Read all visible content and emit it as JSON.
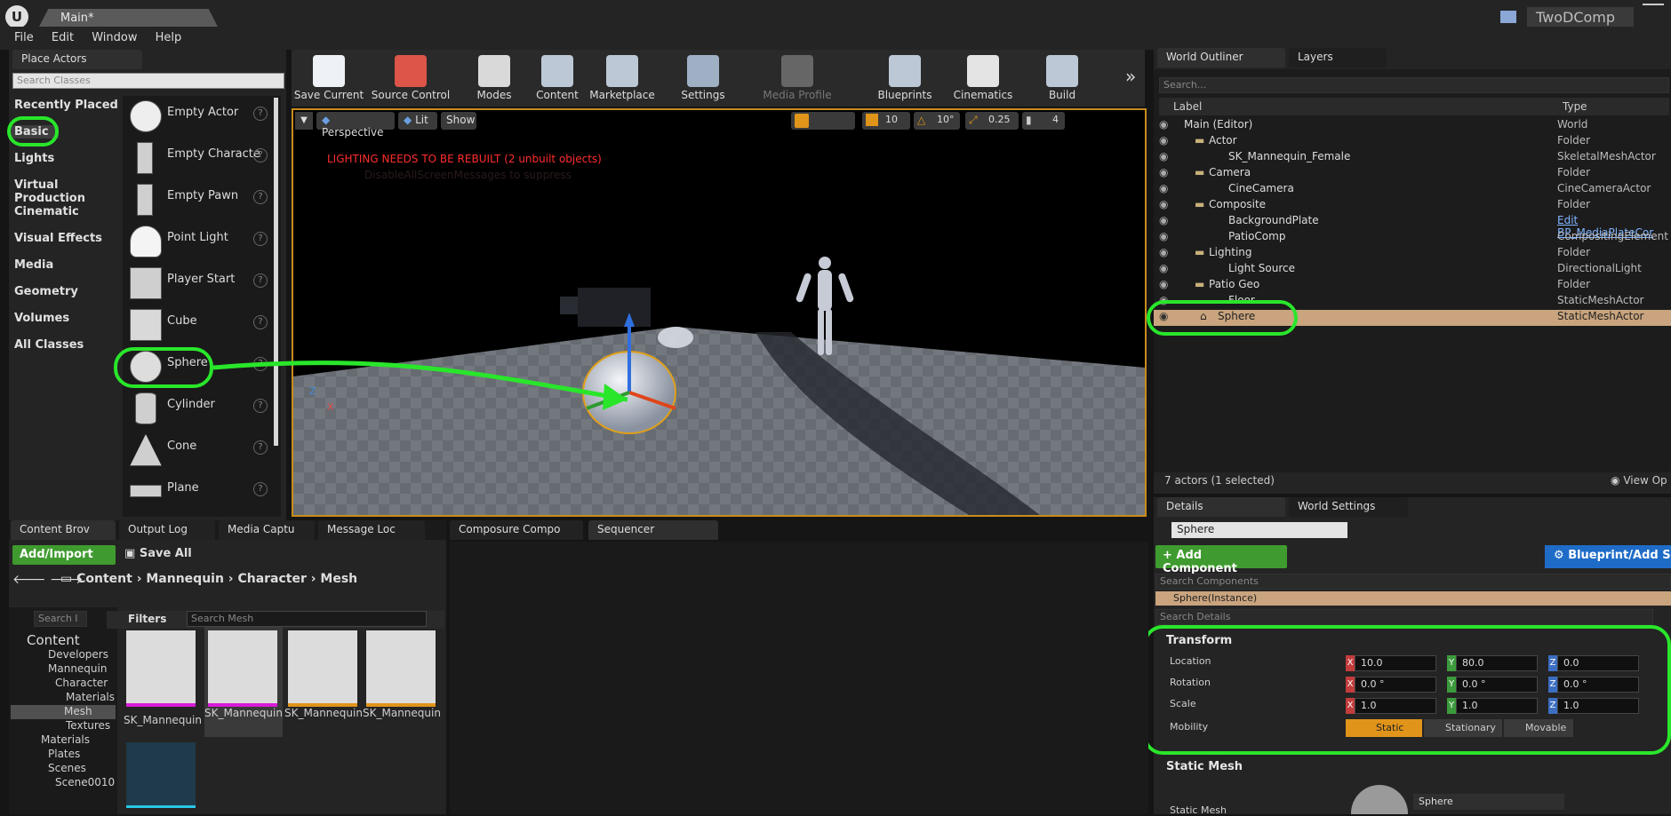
{
  "titlebar": {
    "tab": "Main*",
    "project": "TwoDComp"
  },
  "menu": [
    "File",
    "Edit",
    "Window",
    "Help"
  ],
  "place_actors": {
    "tab": "Place Actors",
    "search_placeholder": "Search Classes",
    "categories": [
      "Recently Placed",
      "Basic",
      "Lights",
      "Virtual Production",
      "Cinematic",
      "Visual Effects",
      "Media",
      "Geometry",
      "Volumes",
      "All Classes"
    ],
    "actors": [
      "Empty Actor",
      "Empty Characte",
      "Empty Pawn",
      "Point Light",
      "Player Start",
      "Cube",
      "Sphere",
      "Cylinder",
      "Cone",
      "Plane"
    ]
  },
  "toolbar": [
    "Save Current",
    "Source Control",
    "Modes",
    "Content",
    "Marketplace",
    "Settings",
    "Media Profile",
    "Blueprints",
    "Cinematics",
    "Build"
  ],
  "viewport": {
    "perspective": "Perspective",
    "lit": "Lit",
    "show": "Show",
    "grid": "10",
    "angle": "10°",
    "scale": "0.25",
    "speed": "4",
    "warning": "LIGHTING NEEDS TO BE REBUILT (2 unbuilt objects)",
    "warning_sub": "DisableAllScreenMessages to suppress"
  },
  "outliner": {
    "tabs": [
      "World Outliner",
      "Layers"
    ],
    "search_placeholder": "Search...",
    "col_label": "Label",
    "col_type": "Type",
    "rows": [
      {
        "label": "Main (Editor)",
        "type": "World"
      },
      {
        "label": "Actor",
        "type": "Folder"
      },
      {
        "label": "SK_Mannequin_Female",
        "type": "SkeletalMeshActor"
      },
      {
        "label": "Camera",
        "type": "Folder"
      },
      {
        "label": "CineCamera",
        "type": "CineCameraActor"
      },
      {
        "label": "Composite",
        "type": "Folder"
      },
      {
        "label": "BackgroundPlate",
        "type": "Edit BP_MediaPlateCor"
      },
      {
        "label": "PatioComp",
        "type": "CompositingElement"
      },
      {
        "label": "Lighting",
        "type": "Folder"
      },
      {
        "label": "Light Source",
        "type": "DirectionalLight"
      },
      {
        "label": "Patio Geo",
        "type": "Folder"
      },
      {
        "label": "Floor",
        "type": "StaticMeshActor"
      },
      {
        "label": "Sphere",
        "type": "StaticMeshActor"
      }
    ],
    "status": "7 actors (1 selected)",
    "view_options": "View Op"
  },
  "details": {
    "tabs": [
      "Details",
      "World Settings"
    ],
    "name": "Sphere",
    "add_component": "+ Add Component",
    "blueprint": "Blueprint/Add Sc",
    "search_components": "Search Components",
    "instance": "Sphere(Instance)",
    "search_details": "Search Details",
    "transform": "Transform",
    "location_label": "Location",
    "rotation_label": "Rotation",
    "scale_label": "Scale",
    "mobility_label": "Mobility",
    "location": [
      "10.0",
      "80.0",
      "0.0"
    ],
    "rotation": [
      "0.0 °",
      "0.0 °",
      "0.0 °"
    ],
    "scale": [
      "1.0",
      "1.0",
      "1.0"
    ],
    "mobility": [
      "Static",
      "Stationary",
      "Movable"
    ],
    "static_mesh_section": "Static Mesh",
    "static_mesh_label": "Static Mesh",
    "static_mesh_value": "Sphere"
  },
  "bottom_tabs": [
    "Content Brov",
    "Output Log",
    "Media Captu",
    "Message Loc",
    "Composure Compo",
    "Sequencer"
  ],
  "content": {
    "add_import": "Add/Import",
    "save_all": "Save All",
    "breadcrumb": [
      "Content",
      "Mannequin",
      "Character",
      "Mesh"
    ],
    "filters": "Filters",
    "search_mesh": "Search Mesh",
    "search_folder": "Search I",
    "tree": [
      "Content",
      "Developers",
      "Mannequin",
      "Character",
      "Materials",
      "Mesh",
      "Textures",
      "Materials",
      "Plates",
      "Scenes",
      "Scene0010"
    ],
    "assets": [
      "SK_Mannequin",
      "SK_Mannequin_Female",
      "SK_Mannequin_Female_PhysicsAsset",
      "SK_Mannequin_PhysicsAsset"
    ]
  }
}
